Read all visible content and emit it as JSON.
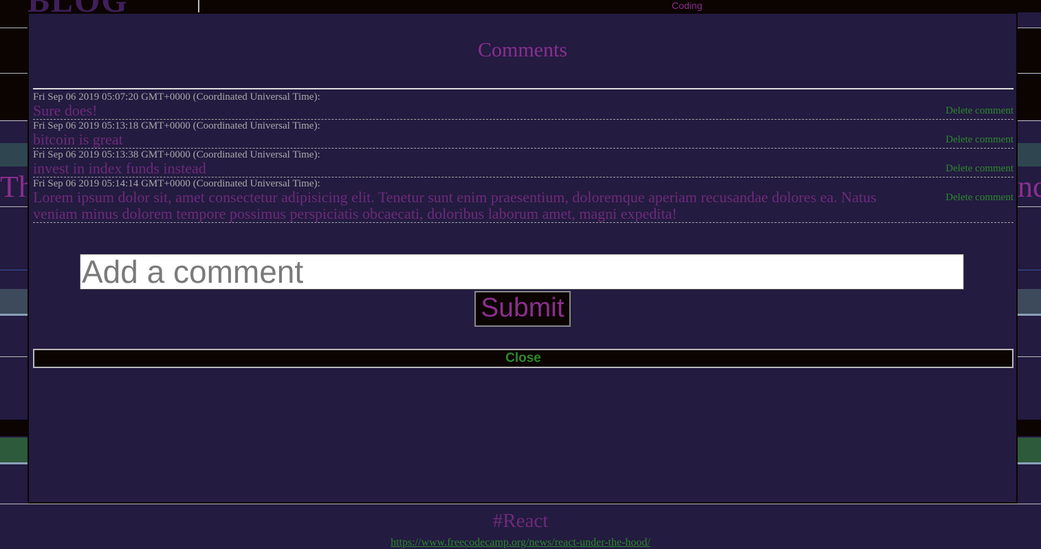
{
  "background": {
    "logo_text": "BLOG BOARD",
    "nav_link": "Coding",
    "title_left": "Th",
    "title_right": "ncy",
    "tag": "#React",
    "url": "https://www.freecodecamp.org/news/react-under-the-hood/"
  },
  "modal": {
    "title": "Comments",
    "comments": [
      {
        "date": "Fri Sep 06 2019 05:07:20 GMT+0000 (Coordinated Universal Time):",
        "text": "Sure does!",
        "delete_label": "Delete comment"
      },
      {
        "date": "Fri Sep 06 2019 05:13:18 GMT+0000 (Coordinated Universal Time):",
        "text": "bitcoin is great",
        "delete_label": "Delete comment"
      },
      {
        "date": "Fri Sep 06 2019 05:13:38 GMT+0000 (Coordinated Universal Time):",
        "text": "invest in index funds instead",
        "delete_label": "Delete comment"
      },
      {
        "date": "Fri Sep 06 2019 05:14:14 GMT+0000 (Coordinated Universal Time):",
        "text": "Lorem ipsum dolor sit, amet consectetur adipisicing elit. Tenetur sunt enim praesentium, doloremque aperiam recusandae dolores ea. Natus veniam minus dolorem tempore possimus perspiciatis obcaecati, doloribus laborum amet, magni expedita!",
        "delete_label": "Delete comment"
      }
    ],
    "input": {
      "placeholder": "Add a comment",
      "value": ""
    },
    "submit_label": "Submit",
    "close_label": "Close"
  },
  "colors": {
    "background": "#231b40",
    "accent_purple": "#8a2f8f",
    "accent_green": "#2c8a2c",
    "dark": "#0c0401"
  }
}
